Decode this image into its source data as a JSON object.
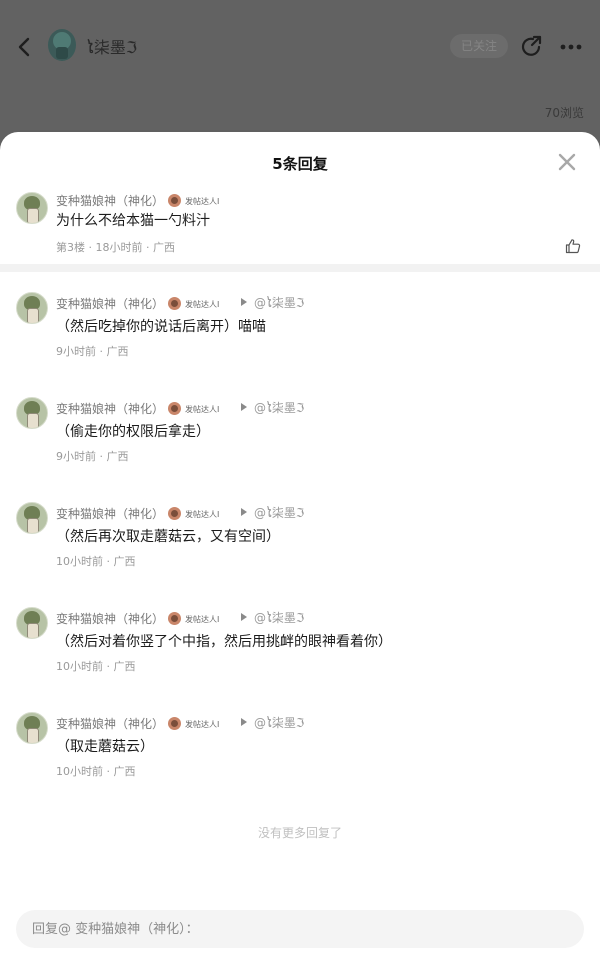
{
  "header": {
    "author_name": "ໄ柒墨ℑ",
    "follow_label": "已关注",
    "views": "70浏览"
  },
  "sheet": {
    "title": "5条回复",
    "main_comment": {
      "author": "变种猫娘神（神化）",
      "badge": "发帖达人I",
      "content": "为什么不给本猫一勺料汁",
      "meta": "第3楼 · 18小时前 · 广西"
    },
    "replies": [
      {
        "author": "变种猫娘神（神化）",
        "badge": "发帖达人I",
        "reply_to": "@ໄ柒墨ℑ",
        "content": "（然后吃掉你的说话后离开）喵喵",
        "meta": "9小时前 · 广西"
      },
      {
        "author": "变种猫娘神（神化）",
        "badge": "发帖达人I",
        "reply_to": "@ໄ柒墨ℑ",
        "content": "（偷走你的权限后拿走）",
        "meta": "9小时前 · 广西"
      },
      {
        "author": "变种猫娘神（神化）",
        "badge": "发帖达人I",
        "reply_to": "@ໄ柒墨ℑ",
        "content": "（然后再次取走蘑菇云，又有空间）",
        "meta": "10小时前 · 广西"
      },
      {
        "author": "变种猫娘神（神化）",
        "badge": "发帖达人I",
        "reply_to": "@ໄ柒墨ℑ",
        "content": "（然后对着你竖了个中指，然后用挑衅的眼神看着你）",
        "meta": "10小时前 · 广西"
      },
      {
        "author": "变种猫娘神（神化）",
        "badge": "发帖达人I",
        "reply_to": "@ໄ柒墨ℑ",
        "content": "（取走蘑菇云）",
        "meta": "10小时前 · 广西"
      }
    ],
    "no_more": "没有更多回复了",
    "reply_placeholder": "回复@ 变种猫娘神（神化）："
  }
}
